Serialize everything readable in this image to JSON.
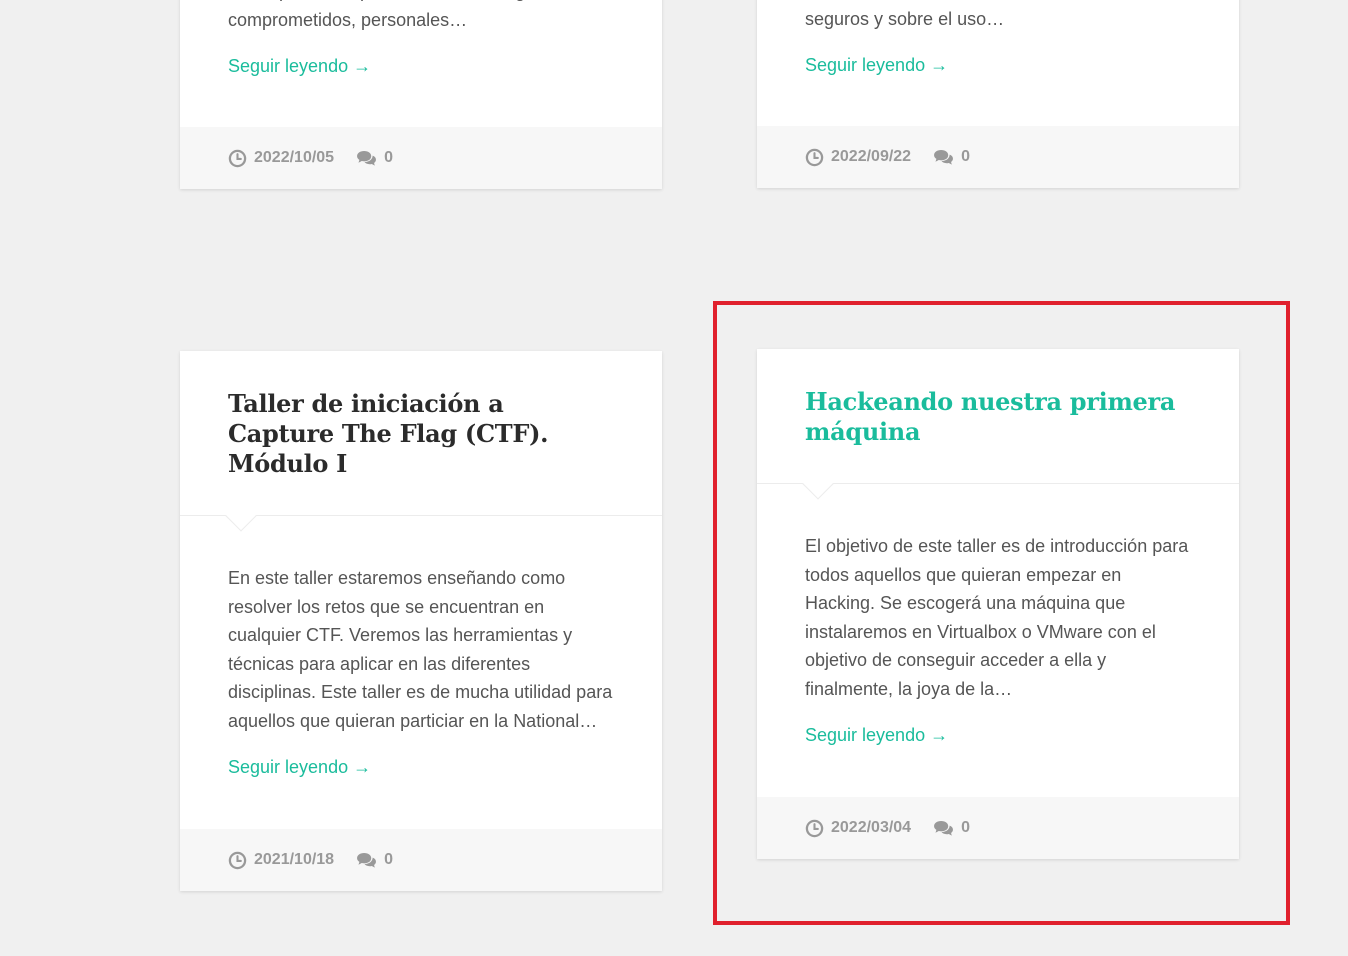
{
  "colors": {
    "accent": "#1abc9c",
    "highlight": "#e0202d",
    "meta_text": "#999999"
  },
  "cards": [
    {
      "title": "",
      "excerpt": "los dispositivos que dan acceso a lugares comprometidos, personales…",
      "read_more": "Seguir leyendo →",
      "date": "2022/10/05",
      "comments": "0",
      "icons": [
        "clock-icon",
        "comments-icon"
      ]
    },
    {
      "title": "",
      "excerpt": "la importancia de invertir en dispositivos seguros y sobre el uso…",
      "read_more": "Seguir leyendo →",
      "date": "2022/09/22",
      "comments": "0",
      "icons": [
        "clock-icon",
        "comments-icon"
      ]
    },
    {
      "title": "Taller de iniciación a Capture The Flag (CTF). Módulo I",
      "excerpt": "En este taller estaremos enseñando como resolver los retos que se encuentran en cualquier CTF. Veremos las herramientas y técnicas para aplicar en las diferentes disciplinas. Este taller es de mucha utilidad para aquellos que quieran particiar en la National…",
      "read_more": "Seguir leyendo →",
      "date": "2021/10/18",
      "comments": "0",
      "icons": [
        "clock-icon",
        "comments-icon"
      ]
    },
    {
      "title": "Hackeando nuestra primera máquina",
      "excerpt": "El objetivo de este taller es de introducción para todos aquellos que quieran  empezar en Hacking. Se escogerá una máquina que instalaremos en Virtualbox o  VMware con el objetivo de conseguir acceder a ella y finalmente, la joya de la…",
      "read_more": "Seguir leyendo →",
      "date": "2022/03/04",
      "comments": "0",
      "icons": [
        "clock-icon",
        "comments-icon"
      ],
      "highlighted": true
    }
  ]
}
